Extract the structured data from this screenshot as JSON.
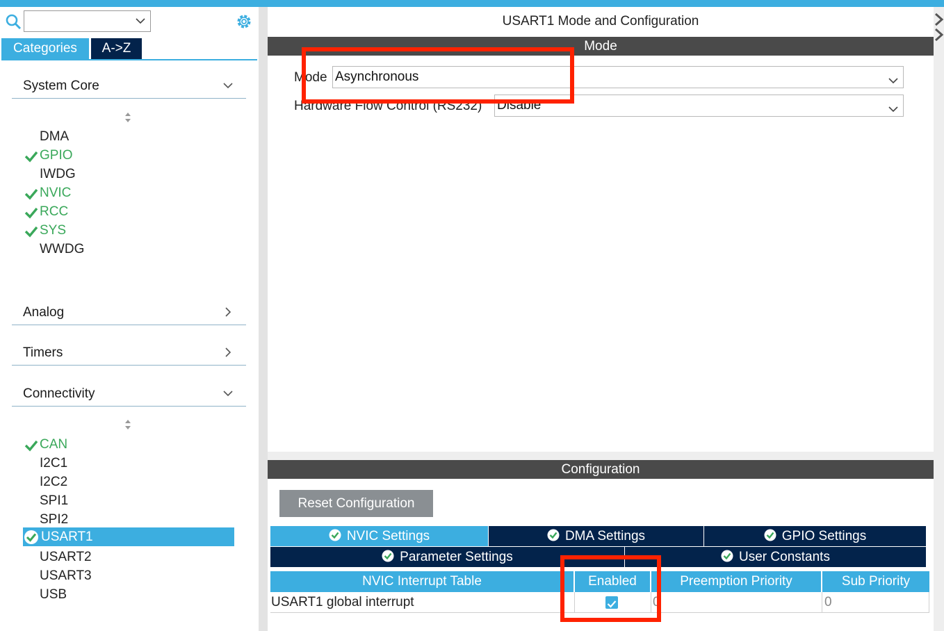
{
  "left": {
    "search": {
      "placeholder": "",
      "value": ""
    },
    "tabs": {
      "categories": "Categories",
      "az": "A->Z"
    },
    "categories": [
      {
        "label": "System Core",
        "state": "expanded"
      },
      {
        "label": "Analog",
        "state": "collapsed"
      },
      {
        "label": "Timers",
        "state": "collapsed"
      },
      {
        "label": "Connectivity",
        "state": "expanded"
      }
    ],
    "system_core_items": [
      {
        "label": "DMA",
        "checked": false
      },
      {
        "label": "GPIO",
        "checked": true
      },
      {
        "label": "IWDG",
        "checked": false
      },
      {
        "label": "NVIC",
        "checked": true
      },
      {
        "label": "RCC",
        "checked": true
      },
      {
        "label": "SYS",
        "checked": true
      },
      {
        "label": "WWDG",
        "checked": false
      }
    ],
    "connectivity_items": [
      {
        "label": "CAN",
        "checked": true
      },
      {
        "label": "I2C1",
        "checked": false
      },
      {
        "label": "I2C2",
        "checked": false
      },
      {
        "label": "SPI1",
        "checked": false
      },
      {
        "label": "SPI2",
        "checked": false
      },
      {
        "label": "USART1",
        "checked": true,
        "selected": true
      },
      {
        "label": "USART2",
        "checked": false
      },
      {
        "label": "USART3",
        "checked": false
      },
      {
        "label": "USB",
        "checked": false
      }
    ]
  },
  "right": {
    "title": "USART1 Mode and Configuration",
    "mode_header": "Mode",
    "mode": {
      "mode_label": "Mode",
      "mode_value": "Asynchronous",
      "flow_label": "Hardware Flow Control (RS232)",
      "flow_value": "Disable"
    },
    "config_header": "Configuration",
    "reset_label": "Reset Configuration",
    "settings_tabs_row1": [
      {
        "label": "NVIC Settings",
        "active": true
      },
      {
        "label": "DMA Settings",
        "active": false
      },
      {
        "label": "GPIO Settings",
        "active": false
      }
    ],
    "settings_tabs_row2": [
      {
        "label": "Parameter Settings",
        "active": false
      },
      {
        "label": "User Constants",
        "active": false
      }
    ],
    "nvic_table": {
      "columns": [
        "NVIC Interrupt Table",
        "Enabled",
        "Preemption Priority",
        "Sub Priority"
      ],
      "rows": [
        {
          "name": "USART1 global interrupt",
          "enabled": true,
          "preemption": "0",
          "sub": "0"
        }
      ]
    }
  },
  "colors": {
    "accent": "#3caee0",
    "dark_tab": "#03234b",
    "band": "#4a4a4a",
    "check_green": "#3aa85a",
    "highlight_red": "#ff2200"
  },
  "icons": [
    "search-icon",
    "gear-icon",
    "chevron-down-icon",
    "chevron-right-icon",
    "sort-icon",
    "check-icon",
    "check-circle-icon",
    "checkbox-checked-icon"
  ]
}
